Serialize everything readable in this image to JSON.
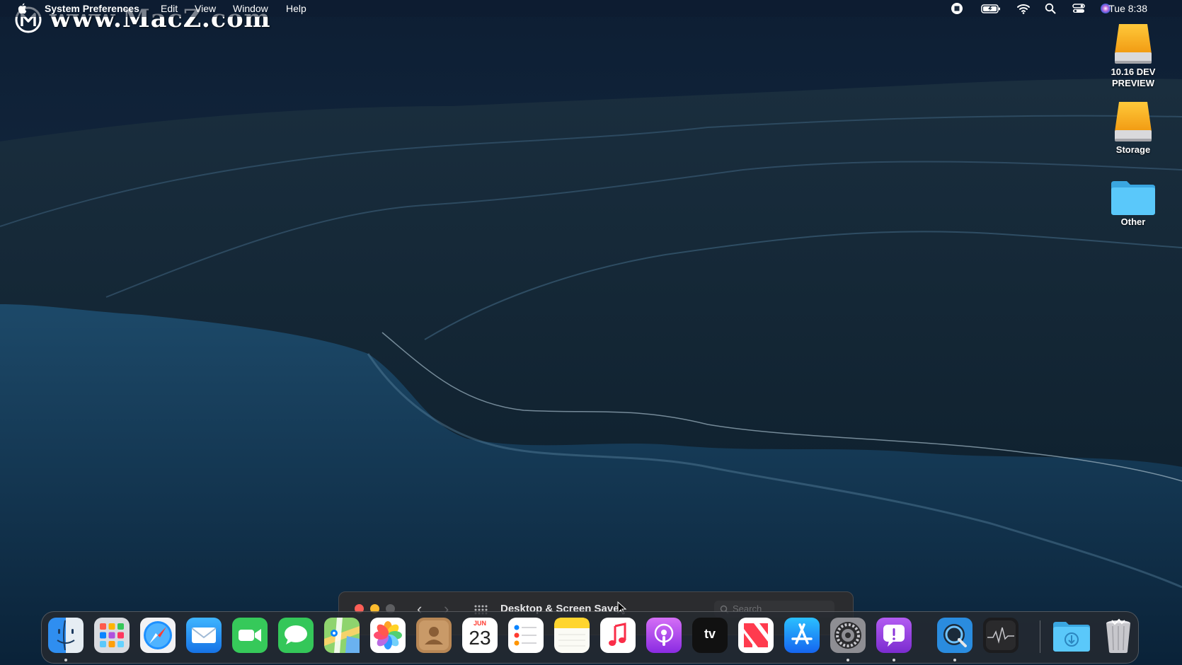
{
  "menubar": {
    "app_name": "System Preferences",
    "menus": [
      "Edit",
      "View",
      "Window",
      "Help"
    ],
    "clock": "Tue 8:38",
    "status_icons": [
      "screen-record-icon",
      "battery-icon",
      "wifi-icon",
      "spotlight-search-icon",
      "control-center-icon",
      "siri-icon"
    ]
  },
  "watermark": {
    "text": "www.MacZ.com"
  },
  "desktop_icons": [
    {
      "label": "10.16 DEV PREVIEW",
      "icon": "hard-drive-icon"
    },
    {
      "label": "Storage",
      "icon": "hard-drive-icon"
    },
    {
      "label": "Other",
      "icon": "folder-icon"
    }
  ],
  "window": {
    "title": "Desktop & Screen Saver",
    "search_placeholder": "Search"
  },
  "dock": {
    "items": [
      "Finder",
      "Launchpad",
      "Safari",
      "Mail",
      "FaceTime",
      "Messages",
      "Maps",
      "Photos",
      "Contacts",
      "Calendar",
      "Reminders",
      "Notes",
      "Music",
      "Podcasts",
      "TV",
      "News",
      "App Store",
      "System Preferences",
      "Feedback Assistant",
      "QuickTime Player",
      "Activity Monitor",
      "Downloads",
      "Trash"
    ],
    "calendar_month": "JUN",
    "calendar_day": "23",
    "tv_label": "tv"
  },
  "colors": {
    "close": "#ff5f57",
    "minimize": "#febc2e",
    "folder": "#5ac8fa",
    "drive": "#f5a623"
  }
}
